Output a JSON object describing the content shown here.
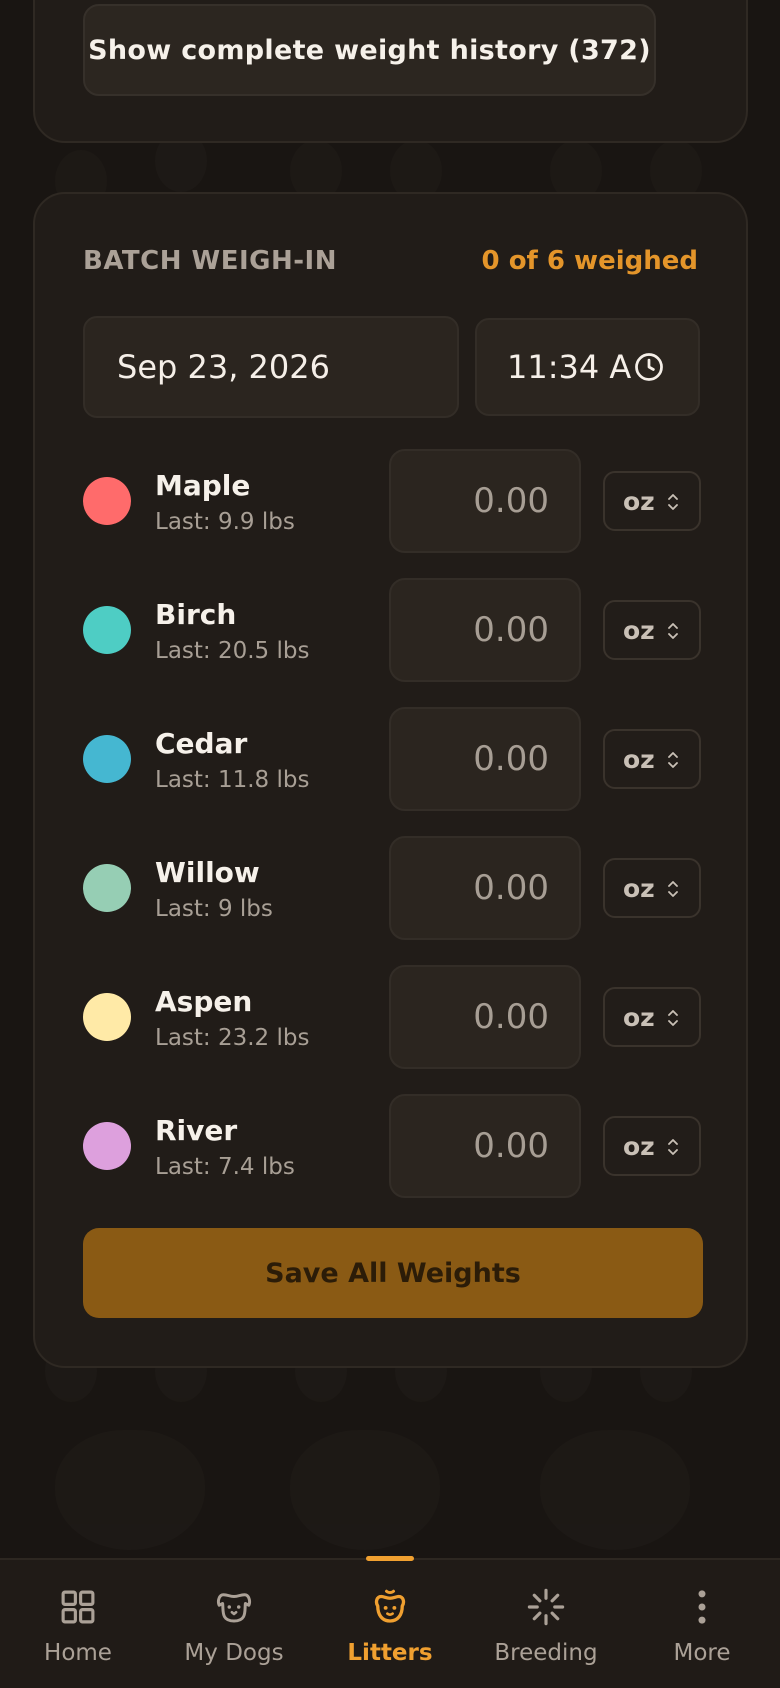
{
  "history": {
    "label": "Show complete weight history (372)"
  },
  "batch": {
    "title": "BATCH WEIGH-IN",
    "count_label": "0 of 6 weighed",
    "date": "Sep 23, 2026",
    "time": "11:34 A",
    "save_label": "Save All Weights",
    "puppies": [
      {
        "name": "Maple",
        "last": "Last: 9.9 lbs",
        "color": "#ff6b6b",
        "placeholder": "0.00",
        "unit": "oz"
      },
      {
        "name": "Birch",
        "last": "Last: 20.5 lbs",
        "color": "#4ecdc4",
        "placeholder": "0.00",
        "unit": "oz"
      },
      {
        "name": "Cedar",
        "last": "Last: 11.8 lbs",
        "color": "#45b7d1",
        "placeholder": "0.00",
        "unit": "oz"
      },
      {
        "name": "Willow",
        "last": "Last: 9 lbs",
        "color": "#96ceb4",
        "placeholder": "0.00",
        "unit": "oz"
      },
      {
        "name": "Aspen",
        "last": "Last: 23.2 lbs",
        "color": "#ffeaa7",
        "placeholder": "0.00",
        "unit": "oz"
      },
      {
        "name": "River",
        "last": "Last: 7.4 lbs",
        "color": "#dda0dd",
        "placeholder": "0.00",
        "unit": "oz"
      }
    ]
  },
  "nav": {
    "items": [
      {
        "label": "Home",
        "icon": "grid-icon"
      },
      {
        "label": "My Dogs",
        "icon": "dog-icon"
      },
      {
        "label": "Litters",
        "icon": "puppy-icon",
        "active": true
      },
      {
        "label": "Breeding",
        "icon": "spark-icon"
      },
      {
        "label": "More",
        "icon": "more-vertical-icon"
      }
    ]
  },
  "colors": {
    "accent": "#f0a030",
    "save_button": "#8a5a14"
  }
}
